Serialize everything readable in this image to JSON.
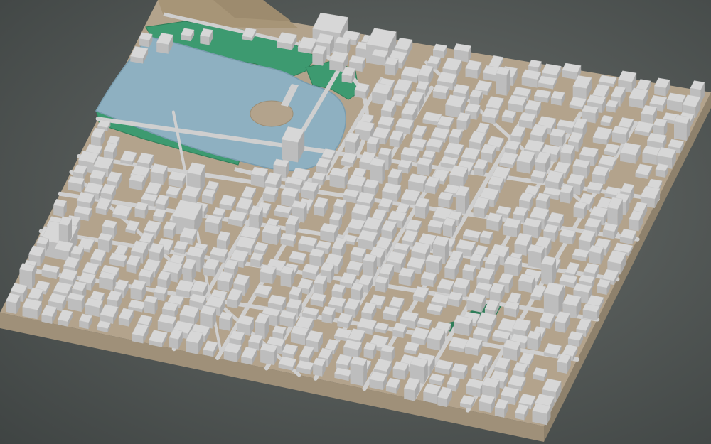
{
  "scene": {
    "type": "3d-city-terrain-model",
    "projection": "isometric",
    "features": [
      "lake",
      "island",
      "parkland",
      "street-grid",
      "buildings",
      "park"
    ],
    "colors": {
      "background": "#575c5a",
      "ground": "#b3a38c",
      "base_side_left": "#9f9079",
      "base_side_front": "#8e816c",
      "water": "#8eb0c1",
      "vegetation": "#3d9a70",
      "vegetation_dark": "#2e7d58",
      "street": "#cfcfcf",
      "building_top": "#d7d7d7",
      "building_left": "#bdbdbd",
      "building_right": "#a9a9a9",
      "hill": "#a79577"
    }
  }
}
